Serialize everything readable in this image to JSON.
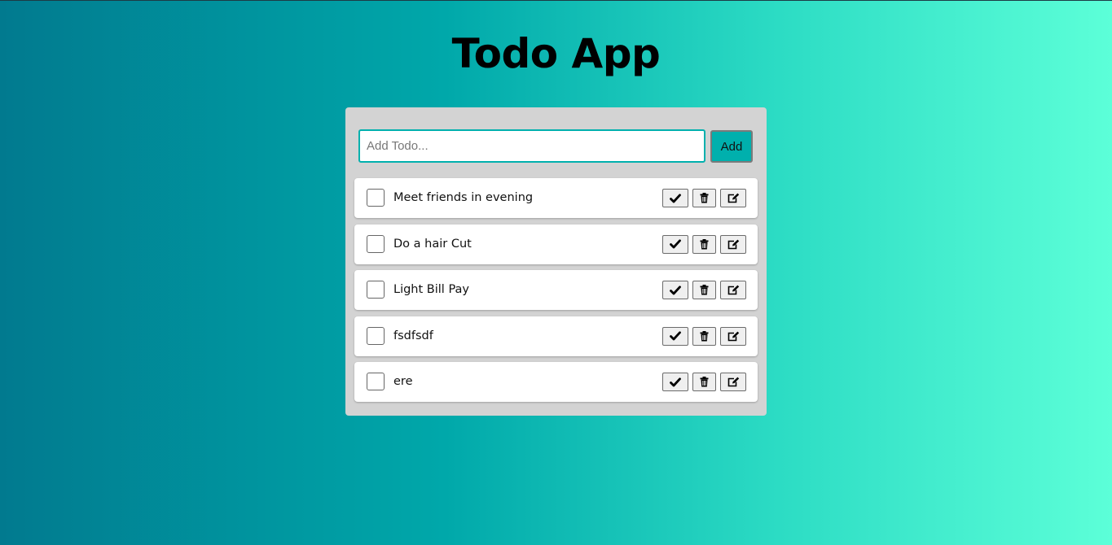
{
  "app": {
    "title": "Todo App"
  },
  "form": {
    "input_placeholder": "Add Todo...",
    "input_value": "",
    "add_label": "Add"
  },
  "todos": [
    {
      "text": "Meet friends in evening",
      "checked": false
    },
    {
      "text": "Do a hair Cut",
      "checked": false
    },
    {
      "text": "Light Bill Pay",
      "checked": false
    },
    {
      "text": "fsdfsdf",
      "checked": false
    },
    {
      "text": "ere",
      "checked": false
    }
  ],
  "icons": {
    "complete": "check-icon",
    "delete": "trash-icon",
    "edit": "edit-icon"
  },
  "colors": {
    "accent": "#00b0ad",
    "panel": "#d3d3d3",
    "gradient_start": "#017a8f",
    "gradient_end": "#5cffd8"
  }
}
